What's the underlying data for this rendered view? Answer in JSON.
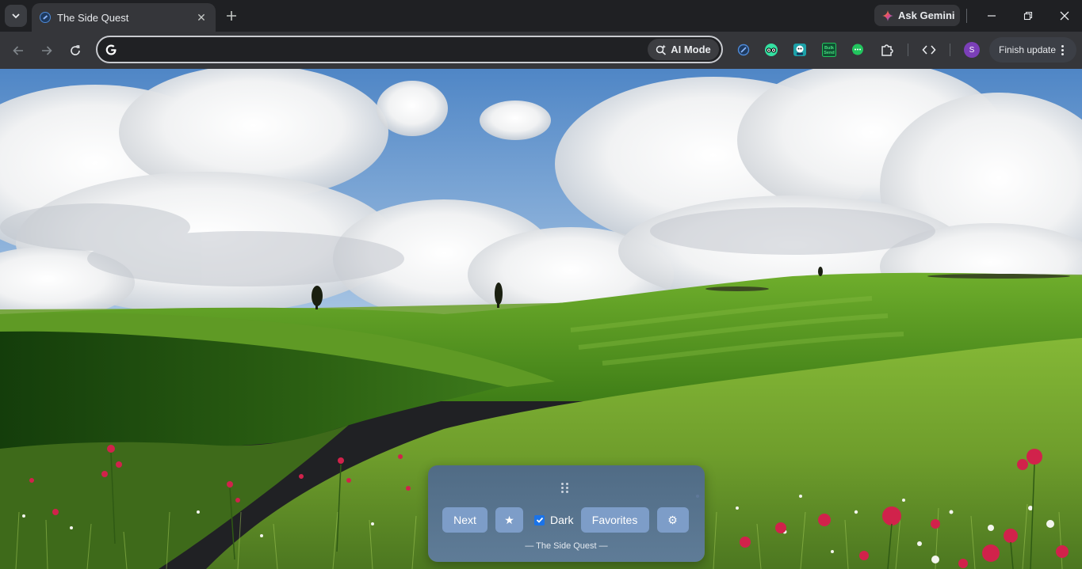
{
  "browser": {
    "tab": {
      "title": "The Side Quest"
    },
    "ask_gemini_label": "Ask Gemini",
    "omnibox": {
      "value": "",
      "ai_mode_label": "AI Mode"
    },
    "extensions": [
      {
        "name": "compass-extension-icon"
      },
      {
        "name": "tripadvisor-extension-icon"
      },
      {
        "name": "puzzle-character-extension-icon"
      },
      {
        "name": "bulk-send-extension-icon",
        "label": "Bulk Send"
      },
      {
        "name": "chat-extension-icon"
      },
      {
        "name": "extensions-puzzle-icon"
      }
    ],
    "profile_initial": "S",
    "finish_update_label": "Finish update"
  },
  "panel": {
    "next_label": "Next",
    "star_symbol": "★",
    "dark_label": "Dark",
    "dark_checked": true,
    "favorites_label": "Favorites",
    "settings_symbol": "⚙",
    "footer": "— The Side Quest —"
  },
  "colors": {
    "accent_blue": "#1a73e8",
    "panel_button": "#7d9dc8",
    "avatar": "#7b3fb8"
  }
}
